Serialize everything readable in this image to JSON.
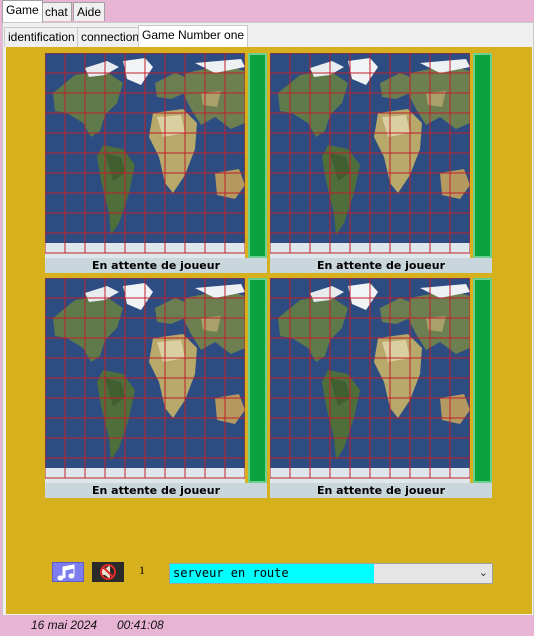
{
  "top_tabs": [
    "Game",
    "chat",
    "Aide"
  ],
  "inner_tabs": [
    "identification",
    "connection",
    "Game Number one"
  ],
  "boards": [
    {
      "label": "En attente de joueur"
    },
    {
      "label": "En attente de joueur"
    },
    {
      "label": "En attente de joueur"
    },
    {
      "label": "En attente de joueur"
    }
  ],
  "controls": {
    "music_icon": "music-note-icon",
    "sound_off_icon": "speaker-muted-icon",
    "count": "1",
    "status_value": "serveur en route"
  },
  "footer": {
    "date": "16 mai 2024",
    "time": "00:41:08"
  },
  "colors": {
    "game_bg": "#d6b11d",
    "chrome_bg": "#e8b4d4",
    "grid_line": "#c0202a",
    "status_highlight": "#00ffff",
    "player_bar": "#0aa33d"
  }
}
